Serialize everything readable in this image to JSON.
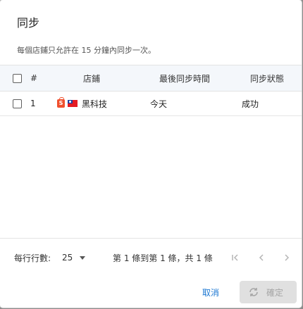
{
  "dialog": {
    "title": "同步",
    "subtitle": "每個店鋪只允許在 15 分鐘內同步一次。"
  },
  "table": {
    "columns": [
      "#",
      "店鋪",
      "最後同步時間",
      "同步狀態"
    ],
    "rows": [
      {
        "index": "1",
        "store_name": "黑科技",
        "last_sync": "今天",
        "status": "成功"
      }
    ]
  },
  "pagination": {
    "rows_per_page_label": "每行行數:",
    "rows_per_page_value": "25",
    "range_text": "第 1 條到第 1 條，共 1 條"
  },
  "actions": {
    "cancel_label": "取消",
    "confirm_label": "確定"
  },
  "icons": {
    "shop": "shopee-bag-icon",
    "flag": "taiwan-flag-icon",
    "first_page": "first-page-icon",
    "prev_page": "chevron-left-icon",
    "next_page": "chevron-right-icon",
    "sync": "sync-icon",
    "dropdown": "caret-down-icon"
  },
  "colors": {
    "accent": "#1976d2",
    "header_bg": "#f4f7fb",
    "disabled_button": "#e0e0e0",
    "shop_icon": "#f0502e"
  }
}
